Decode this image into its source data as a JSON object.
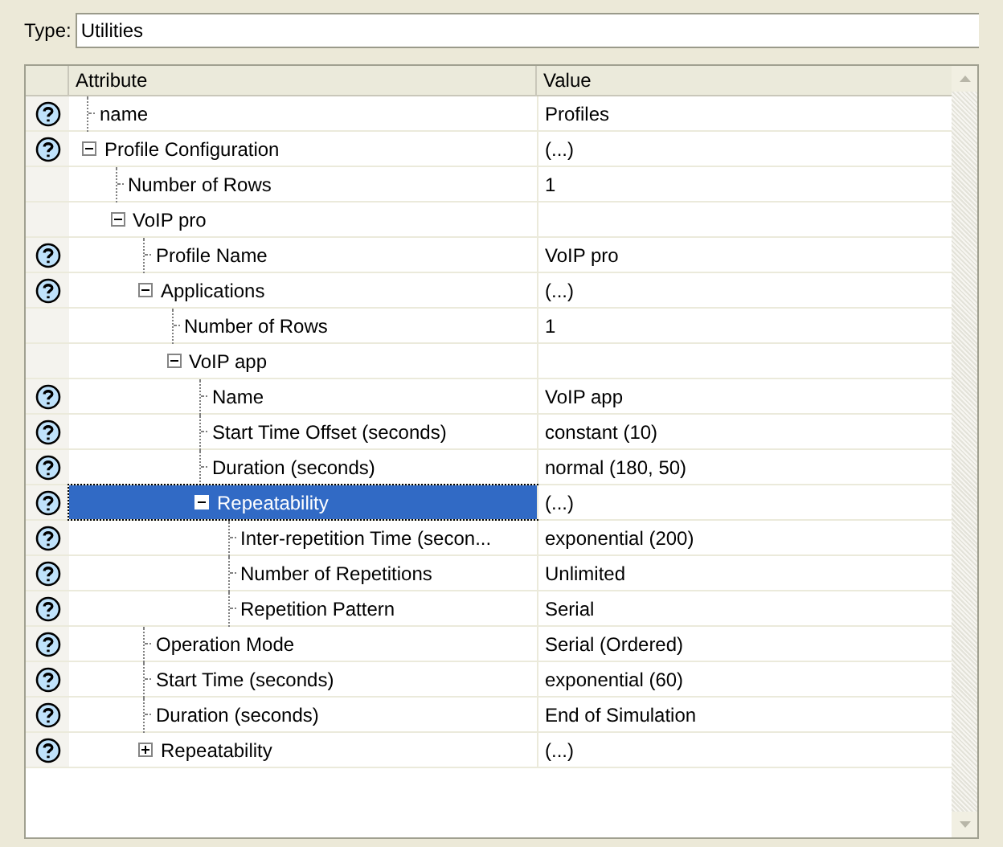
{
  "type_field": {
    "label": "Type:",
    "value": "Utilities"
  },
  "table": {
    "columns": [
      "Attribute",
      "Value"
    ],
    "rows": [
      {
        "label": "name",
        "value": "Profiles",
        "help": true,
        "selected": false
      },
      {
        "label": "Profile Configuration",
        "value": "(...)",
        "help": true,
        "selected": false,
        "expanded": true,
        "children": [
          {
            "label": "Number of Rows",
            "value": "1",
            "help": false,
            "selected": false
          },
          {
            "label": "VoIP pro",
            "help": false,
            "selected": false,
            "expanded": true,
            "children": [
              {
                "label": "Profile Name",
                "value": "VoIP pro",
                "help": true,
                "selected": false
              },
              {
                "label": "Applications",
                "value": "(...)",
                "help": true,
                "selected": false,
                "expanded": true,
                "children": [
                  {
                    "label": "Number of Rows",
                    "value": "1",
                    "help": false,
                    "selected": false
                  },
                  {
                    "label": "VoIP app",
                    "help": false,
                    "selected": false,
                    "expanded": true,
                    "children": [
                      {
                        "label": "Name",
                        "value": "VoIP app",
                        "help": true,
                        "selected": false
                      },
                      {
                        "label": "Start Time Offset (seconds)",
                        "value": "constant (10)",
                        "help": true,
                        "selected": false
                      },
                      {
                        "label": "Duration (seconds)",
                        "value": "normal (180, 50)",
                        "help": true,
                        "selected": false
                      },
                      {
                        "label": "Repeatability",
                        "value": "(...)",
                        "help": true,
                        "selected": true,
                        "expanded": true,
                        "children": [
                          {
                            "label": "Inter-repetition Time (secon...",
                            "value": "exponential (200)",
                            "help": true,
                            "selected": false
                          },
                          {
                            "label": "Number of Repetitions",
                            "value": "Unlimited",
                            "help": true,
                            "selected": false
                          },
                          {
                            "label": "Repetition Pattern",
                            "value": "Serial",
                            "help": true,
                            "selected": false
                          }
                        ]
                      }
                    ]
                  }
                ]
              },
              {
                "label": "Operation Mode",
                "value": "Serial (Ordered)",
                "help": true,
                "selected": false
              },
              {
                "label": "Start Time (seconds)",
                "value": "exponential (60)",
                "help": true,
                "selected": false
              },
              {
                "label": "Duration (seconds)",
                "value": "End of Simulation",
                "help": true,
                "selected": false
              },
              {
                "label": "Repeatability",
                "value": "(...)",
                "help": true,
                "selected": false,
                "expanded": false
              }
            ]
          }
        ]
      }
    ]
  }
}
